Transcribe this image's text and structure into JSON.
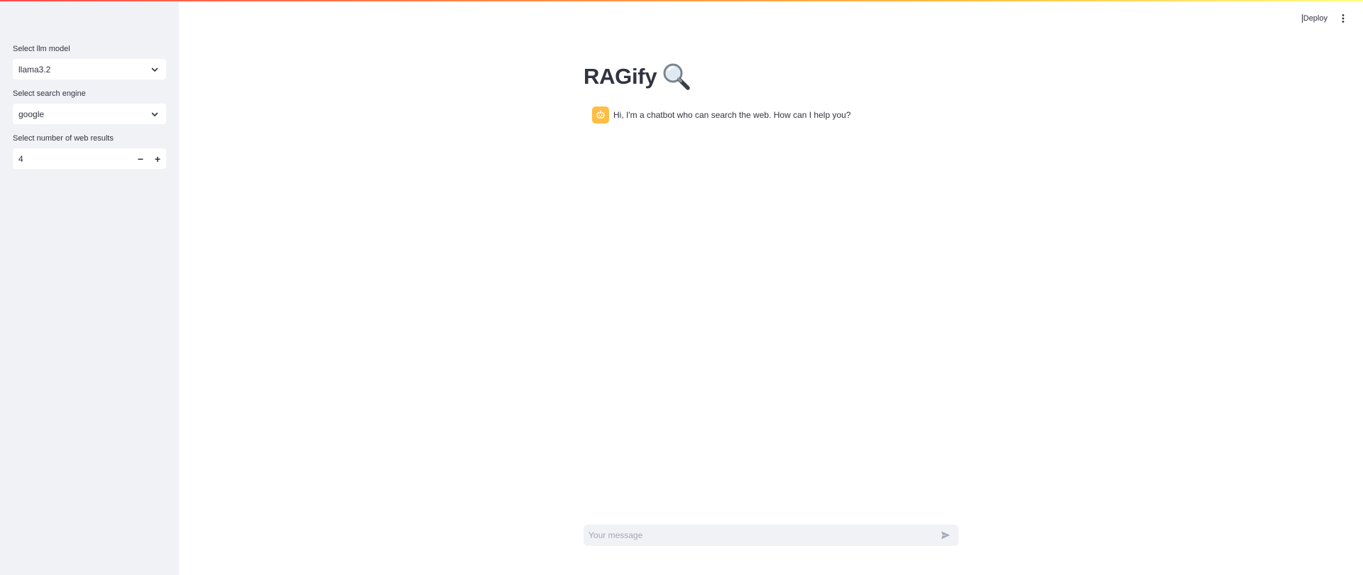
{
  "app": {
    "title": "RAGify"
  },
  "header": {
    "deploy_label": "Deploy",
    "menu_icon": "more-vertical-icon"
  },
  "sidebar": {
    "llm_model": {
      "label": "Select llm model",
      "value": "llama3.2"
    },
    "search_engine": {
      "label": "Select search engine",
      "value": "google"
    },
    "web_results": {
      "label": "Select number of web results",
      "value": "4",
      "decrement": "−",
      "increment": "+"
    }
  },
  "chat": {
    "messages": [
      {
        "role": "assistant",
        "avatar_icon": "bot-icon",
        "text": "Hi, I'm a chatbot who can search the web. How can I help you?"
      }
    ],
    "input": {
      "placeholder": "Your message",
      "value": ""
    }
  },
  "colors": {
    "accent_red": "#ff4b4b",
    "accent_yellow": "#ffbd45",
    "sidebar_bg": "#f0f2f6",
    "text": "#31333f"
  }
}
